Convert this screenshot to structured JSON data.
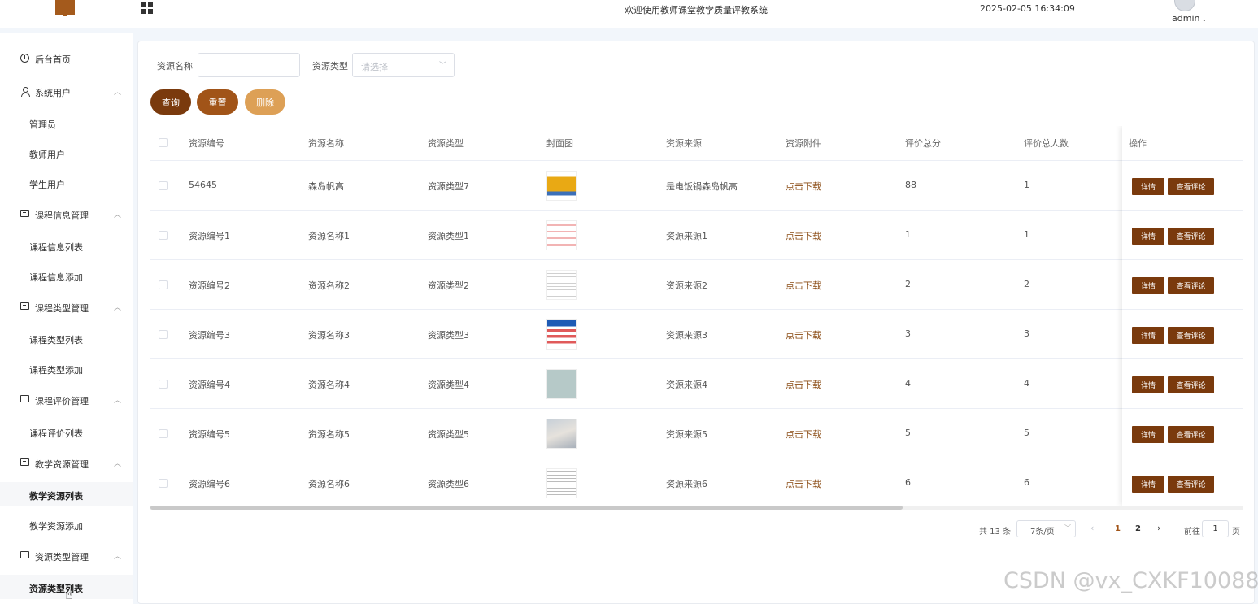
{
  "header": {
    "title": "欢迎使用教师课堂教学质量评教系统",
    "datetime": "2025-02-05 16:34:09",
    "user": "admin",
    "user_caret": "⌄"
  },
  "sidebar": {
    "items": [
      {
        "label": "后台首页",
        "icon": "clock-icon",
        "type": "top"
      },
      {
        "label": "系统用户",
        "icon": "user-icon",
        "type": "group"
      },
      {
        "label": "管理员",
        "type": "sub"
      },
      {
        "label": "教师用户",
        "type": "sub"
      },
      {
        "label": "学生用户",
        "type": "sub"
      },
      {
        "label": "课程信息管理",
        "icon": "list-box-icon",
        "type": "group"
      },
      {
        "label": "课程信息列表",
        "type": "sub"
      },
      {
        "label": "课程信息添加",
        "type": "sub"
      },
      {
        "label": "课程类型管理",
        "icon": "list-box-icon",
        "type": "group"
      },
      {
        "label": "课程类型列表",
        "type": "sub"
      },
      {
        "label": "课程类型添加",
        "type": "sub"
      },
      {
        "label": "课程评价管理",
        "icon": "list-box-icon",
        "type": "group"
      },
      {
        "label": "课程评价列表",
        "type": "sub"
      },
      {
        "label": "教学资源管理",
        "icon": "list-box-icon",
        "type": "group"
      },
      {
        "label": "教学资源列表",
        "type": "sub",
        "active": true
      },
      {
        "label": "教学资源添加",
        "type": "sub"
      },
      {
        "label": "资源类型管理",
        "icon": "list-box-icon",
        "type": "group"
      },
      {
        "label": "资源类型列表",
        "type": "sub"
      }
    ],
    "expand_glyph": "︿"
  },
  "filters": {
    "name_label": "资源名称",
    "name_value": "",
    "type_label": "资源类型",
    "type_placeholder": "请选择"
  },
  "buttons": {
    "query": "查询",
    "reset": "重置",
    "delete": "删除"
  },
  "table": {
    "columns": [
      "资源编号",
      "资源名称",
      "资源类型",
      "封面图",
      "资源来源",
      "资源附件",
      "评价总分",
      "评价总人数",
      "操作"
    ],
    "rows": [
      {
        "code": "54645",
        "name": "森岛帆高",
        "type": "资源类型7",
        "source": "是电饭锅森岛帆高",
        "attachment": "点击下载",
        "score": "88",
        "count": "1"
      },
      {
        "code": "资源编号1",
        "name": "资源名称1",
        "type": "资源类型1",
        "source": "资源来源1",
        "attachment": "点击下载",
        "score": "1",
        "count": "1"
      },
      {
        "code": "资源编号2",
        "name": "资源名称2",
        "type": "资源类型2",
        "source": "资源来源2",
        "attachment": "点击下载",
        "score": "2",
        "count": "2"
      },
      {
        "code": "资源编号3",
        "name": "资源名称3",
        "type": "资源类型3",
        "source": "资源来源3",
        "attachment": "点击下载",
        "score": "3",
        "count": "3"
      },
      {
        "code": "资源编号4",
        "name": "资源名称4",
        "type": "资源类型4",
        "source": "资源来源4",
        "attachment": "点击下载",
        "score": "4",
        "count": "4"
      },
      {
        "code": "资源编号5",
        "name": "资源名称5",
        "type": "资源类型5",
        "source": "资源来源5",
        "attachment": "点击下载",
        "score": "5",
        "count": "5"
      },
      {
        "code": "资源编号6",
        "name": "资源名称6",
        "type": "资源类型6",
        "source": "资源来源6",
        "attachment": "点击下载",
        "score": "6",
        "count": "6"
      }
    ],
    "action_detail": "详情",
    "action_review": "查看评论"
  },
  "pagination": {
    "total_text": "共 13 条",
    "page_size": "7条/页",
    "pages": [
      "1",
      "2"
    ],
    "current_page": "1",
    "goto_label": "前往",
    "goto_value": "1",
    "page_suffix": "页",
    "prev": "‹",
    "next": "›"
  },
  "watermark": "CSDN @vx_CXKF10088",
  "colors": {
    "primary": "#7a3a0d",
    "secondary": "#a15418",
    "danger_light": "#dda056",
    "link": "#8a4a12"
  }
}
